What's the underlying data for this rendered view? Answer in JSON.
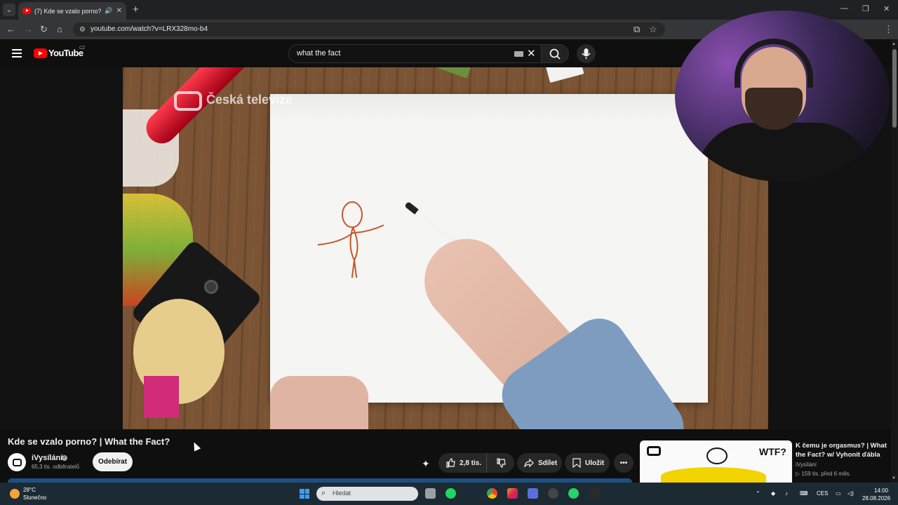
{
  "browser": {
    "tab_title": "(7) Kde se vzalo porno? | W",
    "url": "youtube.com/watch?v=LRX328mo-b4"
  },
  "header": {
    "logo_text": "YouTube",
    "region": "CZ",
    "search_value": "what the fact"
  },
  "player": {
    "watermark": "Česká televize"
  },
  "video": {
    "title": "Kde se vzalo porno? | What the Fact?",
    "channel": "iVysílání",
    "subscribers": "65,3 tis. odběratelů",
    "subscribe_label": "Odebírat",
    "likes": "2,8 tis.",
    "share_label": "Sdílet",
    "save_label": "Uložit"
  },
  "recommendation": {
    "thumb_text": "WTF?",
    "title": "K čemu je orgasmus? | What the Fact? w/ Vyhonit ďábla",
    "channel": "iVysílání",
    "meta": "▷ 159 tis.   před 6 měs."
  },
  "taskbar": {
    "temperature": "28°C",
    "weather": "Slunečno",
    "search_placeholder": "Hledat",
    "language": "CES",
    "time": "14:00",
    "date": "28.08.2026"
  }
}
